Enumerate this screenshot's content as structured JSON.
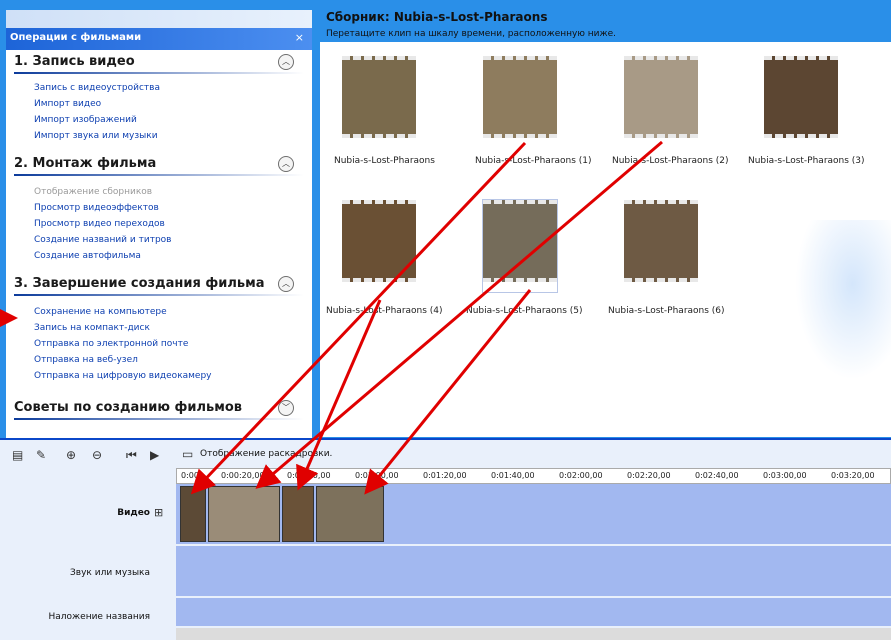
{
  "task_pane": {
    "header": "Операции с фильмами",
    "close": "×",
    "sections": [
      {
        "title": "1. Запись видео",
        "links": [
          "Запись с видеоустройства",
          "Импорт видео",
          "Импорт изображений",
          "Импорт звука или музыки"
        ]
      },
      {
        "title": "2. Монтаж фильма",
        "links": [
          "Отображение сборников",
          "Просмотр видеоэффектов",
          "Просмотр видео переходов",
          "Создание названий и титров",
          "Создание автофильма"
        ]
      },
      {
        "title": "3. Завершение создания фильма",
        "links": [
          "Сохранение на компьютере",
          "Запись на компакт-диск",
          "Отправка по электронной почте",
          "Отправка на веб-узел",
          "Отправка на цифровую видеокамеру"
        ]
      },
      {
        "title": "Советы по созданию фильмов",
        "links": []
      }
    ]
  },
  "collection": {
    "title": "Сборник: Nubia-s-Lost-Pharaons",
    "hint": "Перетащите клип на шкалу времени, расположенную ниже.",
    "clips": [
      "Nubia-s-Lost-Pharaons",
      "Nubia-s-Lost-Pharaons (1)",
      "Nubia-s-Lost-Pharaons (2)",
      "Nubia-s-Lost-Pharaons (3)",
      "Nubia-s-Lost-Pharaons (4)",
      "Nubia-s-Lost-Pharaons (5)",
      "Nubia-s-Lost-Pharaons (6)"
    ]
  },
  "toolbar": {
    "storyboard": "Отображение раскадровки."
  },
  "timeline": {
    "ticks": [
      "0:00",
      "0:00:20,00",
      "0:00:40,00",
      "0:01:00,00",
      "0:01:20,00",
      "0:01:40,00",
      "0:02:00,00",
      "0:02:20,00",
      "0:02:40,00",
      "0:03:00,00",
      "0:03:20,00"
    ],
    "tracks": {
      "video": "Видео",
      "audio": "Звук или музыка",
      "title": "Наложение названия"
    }
  }
}
